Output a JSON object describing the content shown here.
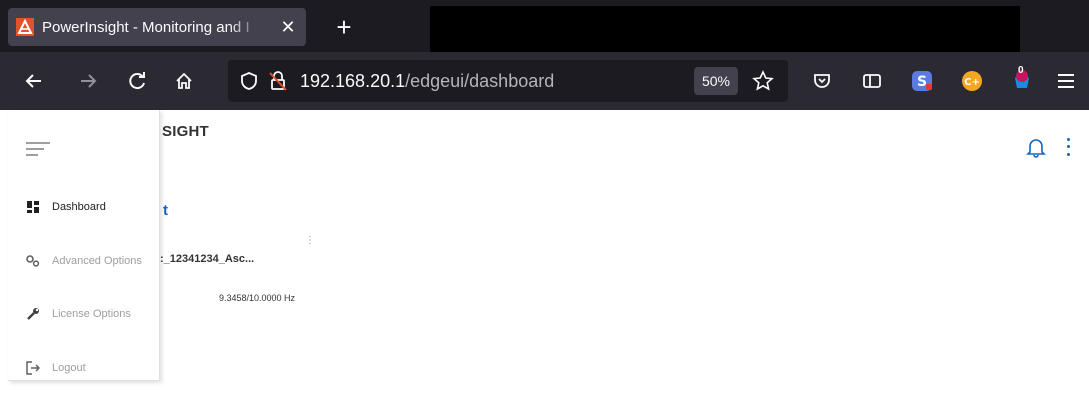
{
  "browser": {
    "tab_title": "PowerInsight - Monitoring and I",
    "tab_close": "✕",
    "new_tab": "+",
    "url_host": "192.168.20.1",
    "url_path": "/edgeui/dashboard",
    "zoom": "50%",
    "extension_badge": "0"
  },
  "app": {
    "brand": "SIGHT",
    "peek_heading": "t",
    "peek_device_name": ":_12341234_Asc...",
    "peek_frequency": "9.3458/10.0000 Hz",
    "peek_more": "⋮"
  },
  "sidebar": {
    "items": [
      {
        "label": "Dashboard",
        "icon": "dashboard-icon",
        "active": true
      },
      {
        "label": "Advanced Options",
        "icon": "gears-icon",
        "active": false
      },
      {
        "label": "License Options",
        "icon": "wrench-icon",
        "active": false
      },
      {
        "label": "Logout",
        "icon": "logout-icon",
        "active": false
      }
    ]
  },
  "colors": {
    "chrome_dark": "#1c1b22",
    "chrome_nav": "#2b2a33",
    "brand_accent": "#e0522c",
    "app_blue": "#1565c0"
  }
}
